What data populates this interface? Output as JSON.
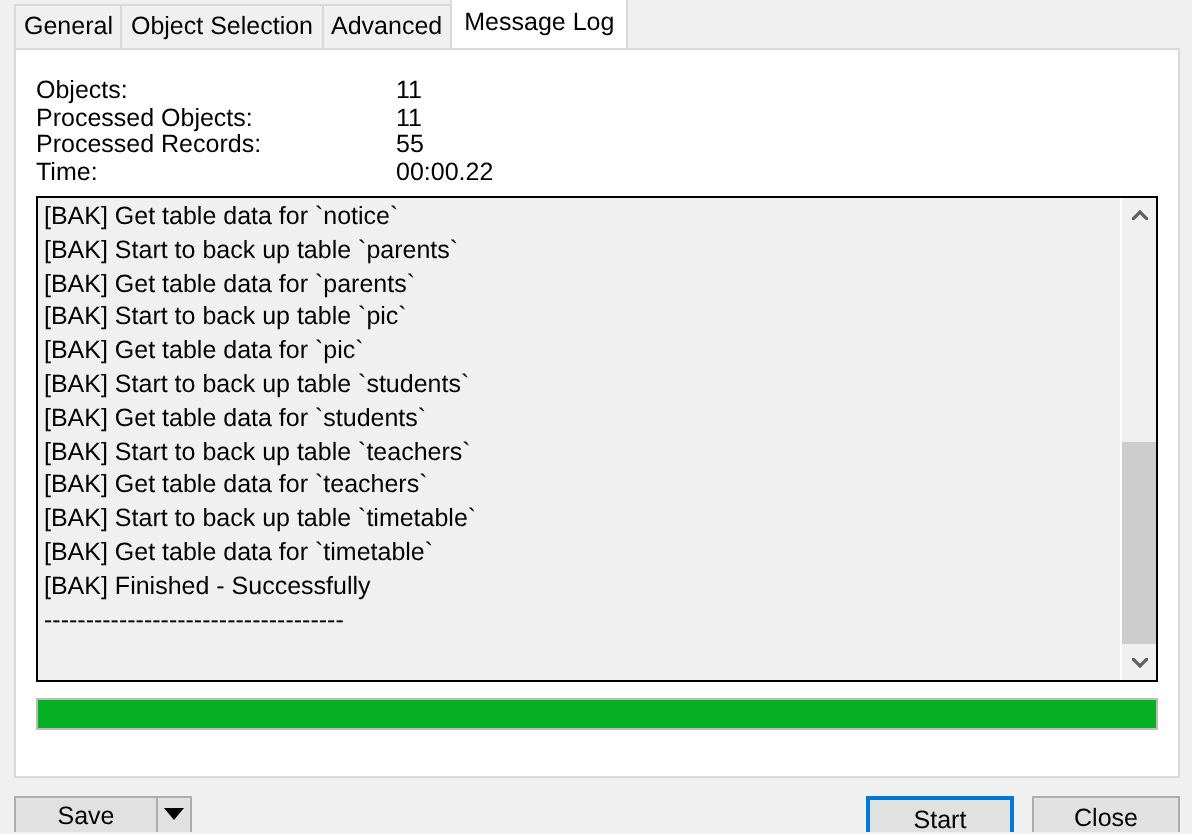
{
  "tabs": [
    {
      "label": "General",
      "selected": false
    },
    {
      "label": "Object Selection",
      "selected": false
    },
    {
      "label": "Advanced",
      "selected": false
    },
    {
      "label": "Message Log",
      "selected": true
    }
  ],
  "stats": [
    {
      "label": "Objects:",
      "value": "11"
    },
    {
      "label": "Processed Objects:",
      "value": "11"
    },
    {
      "label": "Processed Records:",
      "value": "55"
    },
    {
      "label": "Time:",
      "value": "00:00.22"
    }
  ],
  "log": [
    "[BAK] Get table data for `notice`",
    "[BAK] Start to back up table `parents`",
    "[BAK] Get table data for `parents`",
    "[BAK] Start to back up table `pic`",
    "[BAK] Get table data for `pic`",
    "[BAK] Start to back up table `students`",
    "[BAK] Get table data for `students`",
    "[BAK] Start to back up table `teachers`",
    "[BAK] Get table data for `teachers`",
    "[BAK] Start to back up table `timetable`",
    "[BAK] Get table data for `timetable`",
    "[BAK] Finished - Successfully",
    "------------------------------------"
  ],
  "progress": {
    "level": 1
  },
  "buttons": {
    "save": "Save",
    "start": "Start",
    "close": "Close"
  }
}
